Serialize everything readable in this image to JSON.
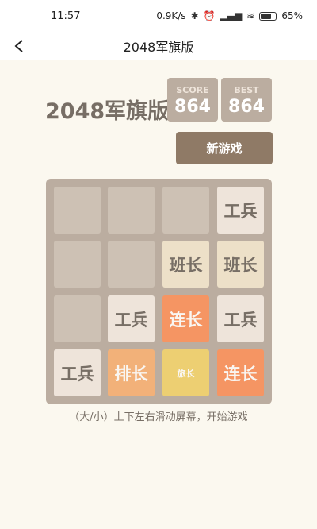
{
  "status": {
    "time": "11:57",
    "net_speed": "0.9K/s",
    "battery": "65%"
  },
  "appbar": {
    "title": "2048军旗版"
  },
  "game": {
    "title": "2048军旗版",
    "score_label": "SCORE",
    "score": "864",
    "best_label": "BEST",
    "best": "864",
    "new_game": "新游戏"
  },
  "board": {
    "rows": [
      [
        "",
        "",
        "",
        "工兵"
      ],
      [
        "",
        "",
        "班长",
        "班长"
      ],
      [
        "",
        "工兵",
        "连长",
        "工兵"
      ],
      [
        "工兵",
        "排长",
        "旅长",
        "连长"
      ]
    ]
  },
  "hint": "（大/小）上下左右滑动屏幕，开始游戏",
  "colors": {
    "background": "#fbf8ef",
    "board": "#bbada0",
    "empty_cell": "#cdc1b4",
    "button": "#8f7a66"
  }
}
